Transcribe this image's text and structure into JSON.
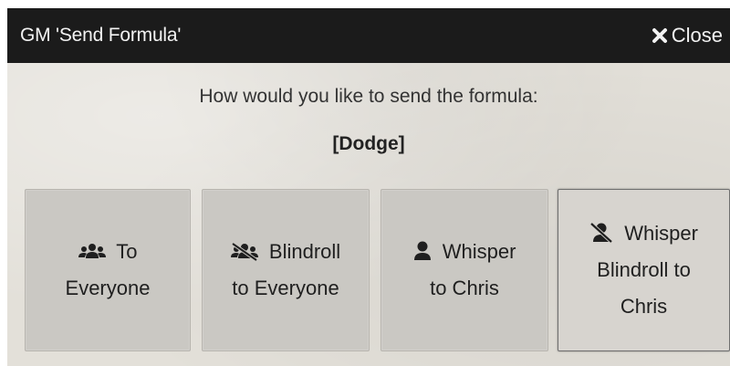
{
  "dialog": {
    "title": "GM 'Send Formula'",
    "close_label": "Close",
    "close_icon": "close-icon"
  },
  "content": {
    "prompt": "How would you like to send the formula:",
    "formula": "[Dodge]"
  },
  "buttons": [
    {
      "icon": "users-icon",
      "line1": "To",
      "line2": "Everyone"
    },
    {
      "icon": "users-slash-icon",
      "line1": "Blindroll",
      "line2": "to Everyone"
    },
    {
      "icon": "user-icon",
      "line1": "Whisper",
      "line2": "to Chris"
    },
    {
      "icon": "user-slash-icon",
      "line1": "Whisper",
      "line2": "Blindroll to",
      "line3": "Chris"
    }
  ],
  "colors": {
    "titlebar": "#1b1b1b",
    "panel": "#e3e0d9",
    "button": "#cac8c3",
    "button_active_border": "#6f6f6f"
  }
}
